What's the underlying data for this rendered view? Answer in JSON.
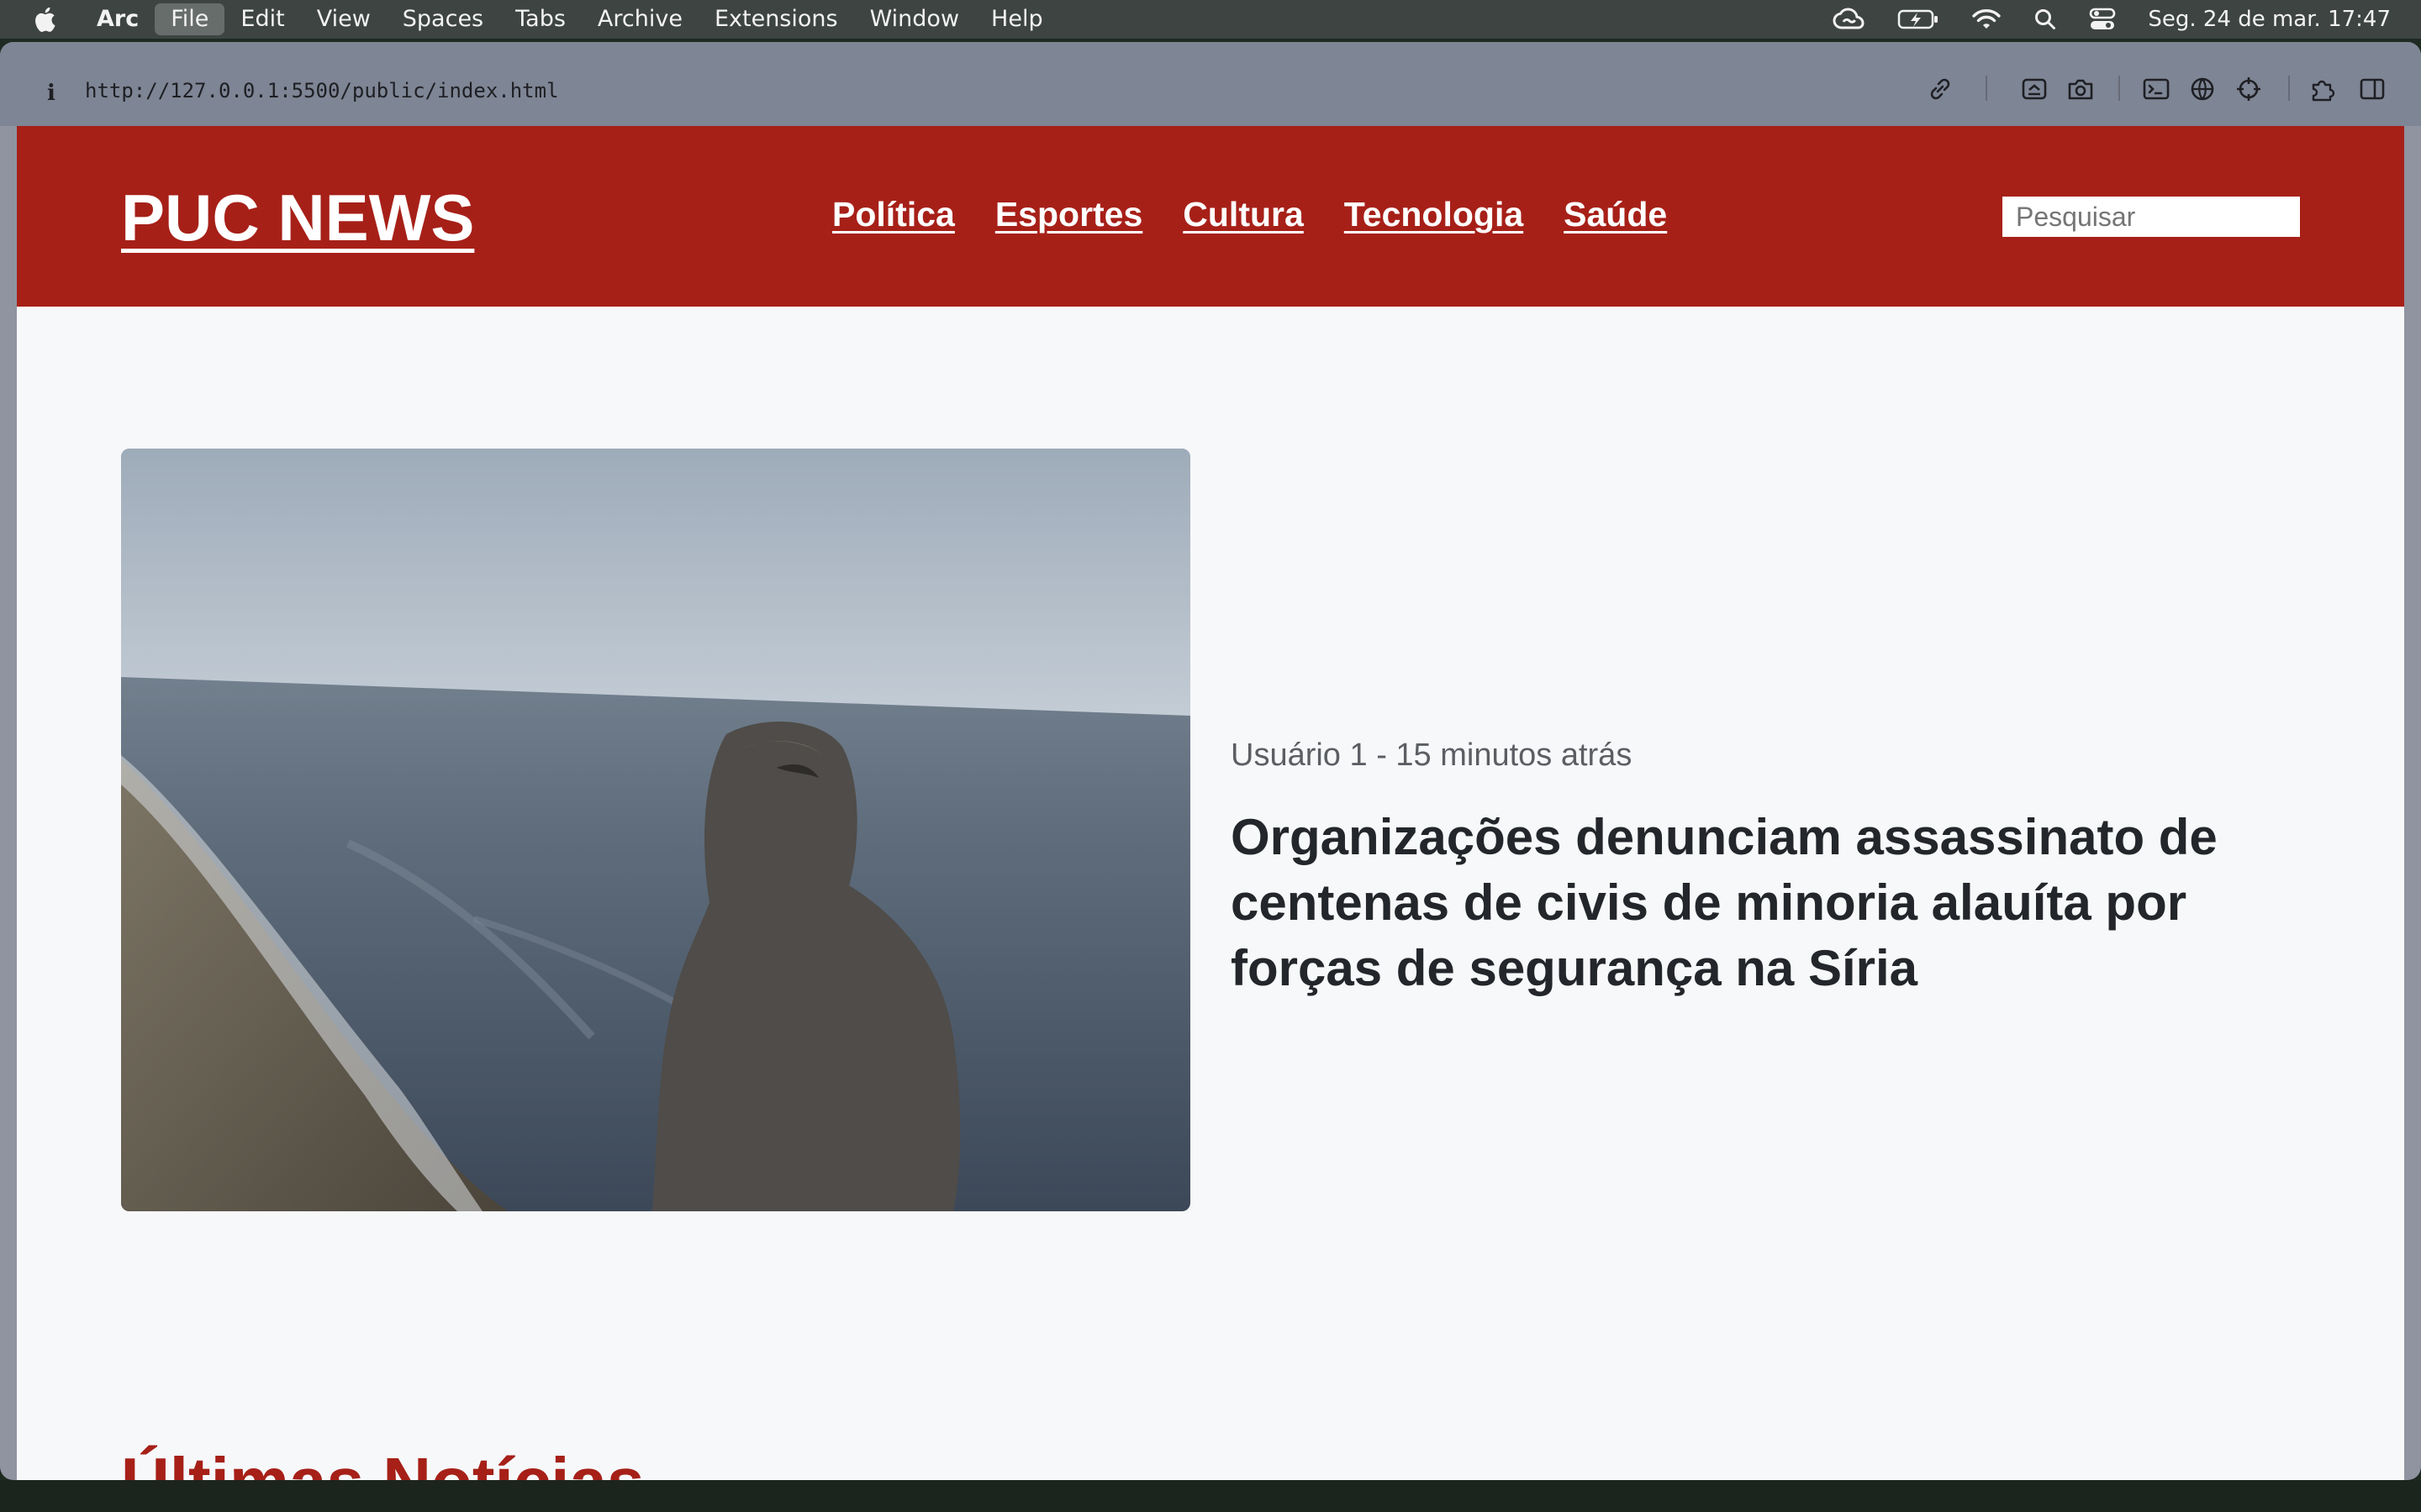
{
  "menubar": {
    "app_name": "Arc",
    "items": [
      "File",
      "Edit",
      "View",
      "Spaces",
      "Tabs",
      "Archive",
      "Extensions",
      "Window",
      "Help"
    ],
    "active_item": "File",
    "clock": "Seg. 24 de mar.  17:47",
    "status_icons": [
      "creative-cloud-icon",
      "battery-charging-icon",
      "wifi-icon",
      "search-icon",
      "control-center-icon"
    ]
  },
  "browser": {
    "url": "http://127.0.0.1:5500/public/index.html",
    "info_icon": "i",
    "toolbar_icons": [
      "link-icon",
      "capture-icon",
      "camera-icon",
      "terminal-icon",
      "globe-icon",
      "crosshair-icon",
      "extensions-icon",
      "sidebar-icon"
    ]
  },
  "site": {
    "logo": "PUC NEWS",
    "nav": [
      "Política",
      "Esportes",
      "Cultura",
      "Tecnologia",
      "Saúde"
    ],
    "search_placeholder": "Pesquisar",
    "brand_color": "#a62018"
  },
  "featured": {
    "meta": "Usuário 1 - 15 minutos atrás",
    "title": "Organizações denunciam assassinato de centenas de civis de minoria alauíta por forças de segurança na Síria"
  },
  "latest": {
    "title": "Últimas Notícias"
  }
}
